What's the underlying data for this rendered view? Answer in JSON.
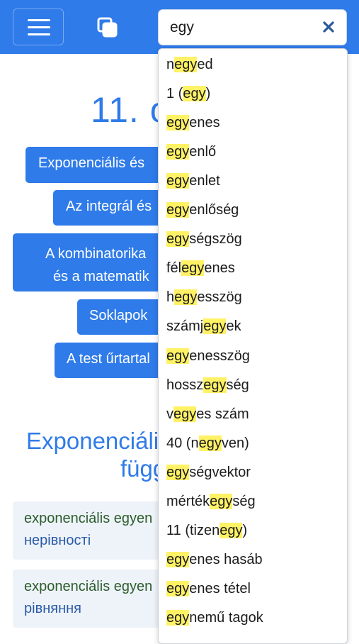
{
  "search": {
    "value": "egy"
  },
  "main": {
    "title": "11. o",
    "topics": [
      {
        "lines": [
          "Exponenciális és"
        ]
      },
      {
        "lines": [
          "Az integrál és"
        ]
      },
      {
        "lines": [
          "A kombinatorika",
          "és a matematik"
        ]
      },
      {
        "lines": [
          "Soklapok"
        ]
      },
      {
        "lines": [
          "A test űrtartal"
        ]
      }
    ],
    "section_title": {
      "line1": "Exponenciáli",
      "line2": "függ"
    },
    "cards": [
      {
        "hu": "exponenciális egyen",
        "ua": "нерівності"
      },
      {
        "hu": "exponenciális egyen",
        "ua": "рівняння"
      }
    ]
  },
  "dropdown": {
    "items": [
      {
        "before": "n",
        "match": "egy",
        "after": "ed"
      },
      {
        "before": "1 (",
        "match": "egy",
        "after": ")"
      },
      {
        "before": "",
        "match": "egy",
        "after": "enes"
      },
      {
        "before": "",
        "match": "egy",
        "after": "enlő"
      },
      {
        "before": "",
        "match": "egy",
        "after": "enlet"
      },
      {
        "before": "",
        "match": "egy",
        "after": "enlőség"
      },
      {
        "before": "",
        "match": "egy",
        "after": "ségszög"
      },
      {
        "before": "fél",
        "match": "egy",
        "after": "enes"
      },
      {
        "before": "h",
        "match": "egy",
        "after": "esszög"
      },
      {
        "before": "számj",
        "match": "egy",
        "after": "ek"
      },
      {
        "before": "",
        "match": "egy",
        "after": "enesszög"
      },
      {
        "before": "hossz",
        "match": "egy",
        "after": "ség"
      },
      {
        "before": "v",
        "match": "egy",
        "after": "es szám"
      },
      {
        "before": "40 (n",
        "match": "egy",
        "after": "ven)"
      },
      {
        "before": "",
        "match": "egy",
        "after": "ségvektor"
      },
      {
        "before": "mérték",
        "match": "egy",
        "after": "ség"
      },
      {
        "before": "11 (tizen",
        "match": "egy",
        "after": ")"
      },
      {
        "before": "",
        "match": "egy",
        "after": "enes hasáb"
      },
      {
        "before": "",
        "match": "egy",
        "after": "enes tétel"
      },
      {
        "before": "",
        "match": "egy",
        "after": "nemű tagok"
      }
    ]
  },
  "colors": {
    "accent": "#2f7be9",
    "highlight": "#fff265"
  },
  "icons": {
    "menu": "hamburger-icon",
    "copy": "copy-icon",
    "clear": "close-icon"
  }
}
